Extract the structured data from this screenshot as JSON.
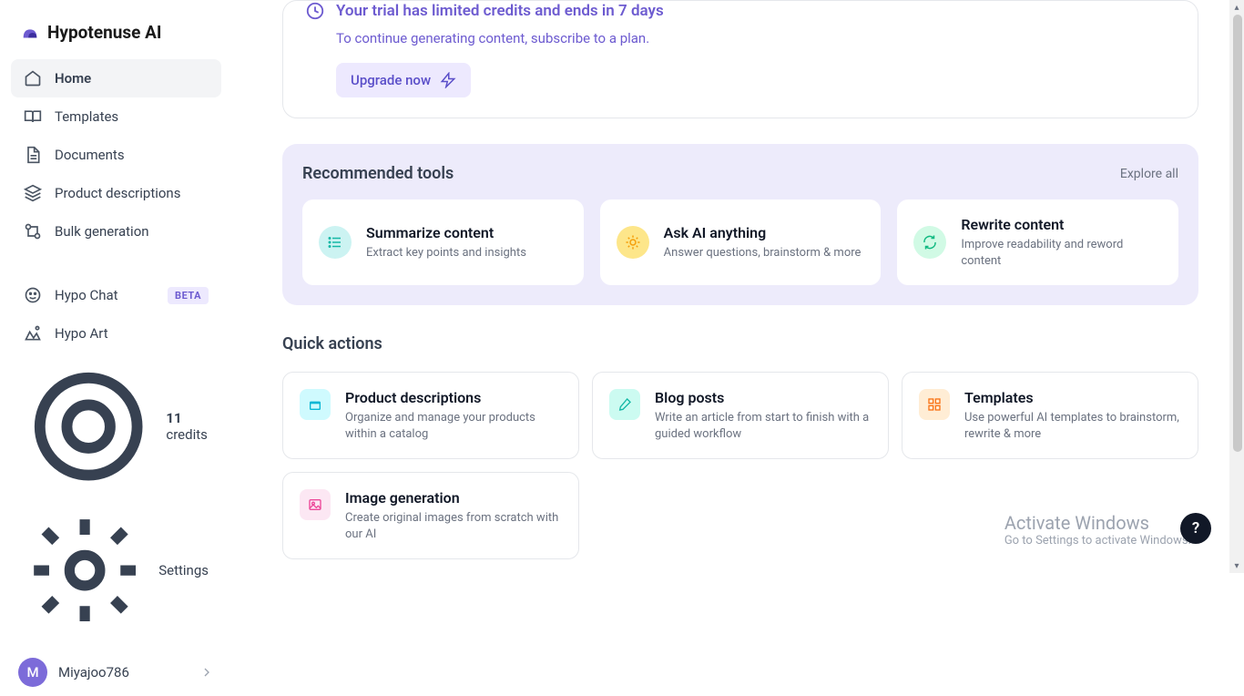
{
  "brand": {
    "name": "Hypotenuse AI"
  },
  "sidebar": {
    "items": [
      {
        "label": "Home"
      },
      {
        "label": "Templates"
      },
      {
        "label": "Documents"
      },
      {
        "label": "Product descriptions"
      },
      {
        "label": "Bulk generation"
      }
    ],
    "secondary": [
      {
        "label": "Hypo Chat",
        "badge": "BETA"
      },
      {
        "label": "Hypo Art"
      }
    ],
    "credits": {
      "count": "11",
      "label": "credits"
    },
    "settings_label": "Settings",
    "user": {
      "initial": "M",
      "name": "Miyajoo786"
    }
  },
  "trial": {
    "title": "Your trial has limited credits and ends in 7 days",
    "subtitle": "To continue generating content, subscribe to a plan.",
    "cta": "Upgrade now"
  },
  "recommended": {
    "heading": "Recommended tools",
    "explore": "Explore all",
    "tools": [
      {
        "title": "Summarize content",
        "desc": "Extract key points and insights"
      },
      {
        "title": "Ask AI anything",
        "desc": "Answer questions, brainstorm & more"
      },
      {
        "title": "Rewrite content",
        "desc": "Improve readability and reword content"
      }
    ]
  },
  "quick": {
    "heading": "Quick actions",
    "cards": [
      {
        "title": "Product descriptions",
        "desc": "Organize and manage your products within a catalog"
      },
      {
        "title": "Blog posts",
        "desc": "Write an article from start to finish with a guided workflow"
      },
      {
        "title": "Templates",
        "desc": "Use powerful AI templates to brainstorm, rewrite & more"
      },
      {
        "title": "Image generation",
        "desc": "Create original images from scratch with our AI"
      }
    ]
  },
  "watermark": {
    "title": "Activate Windows",
    "subtitle": "Go to Settings to activate Windows."
  },
  "help": "?"
}
